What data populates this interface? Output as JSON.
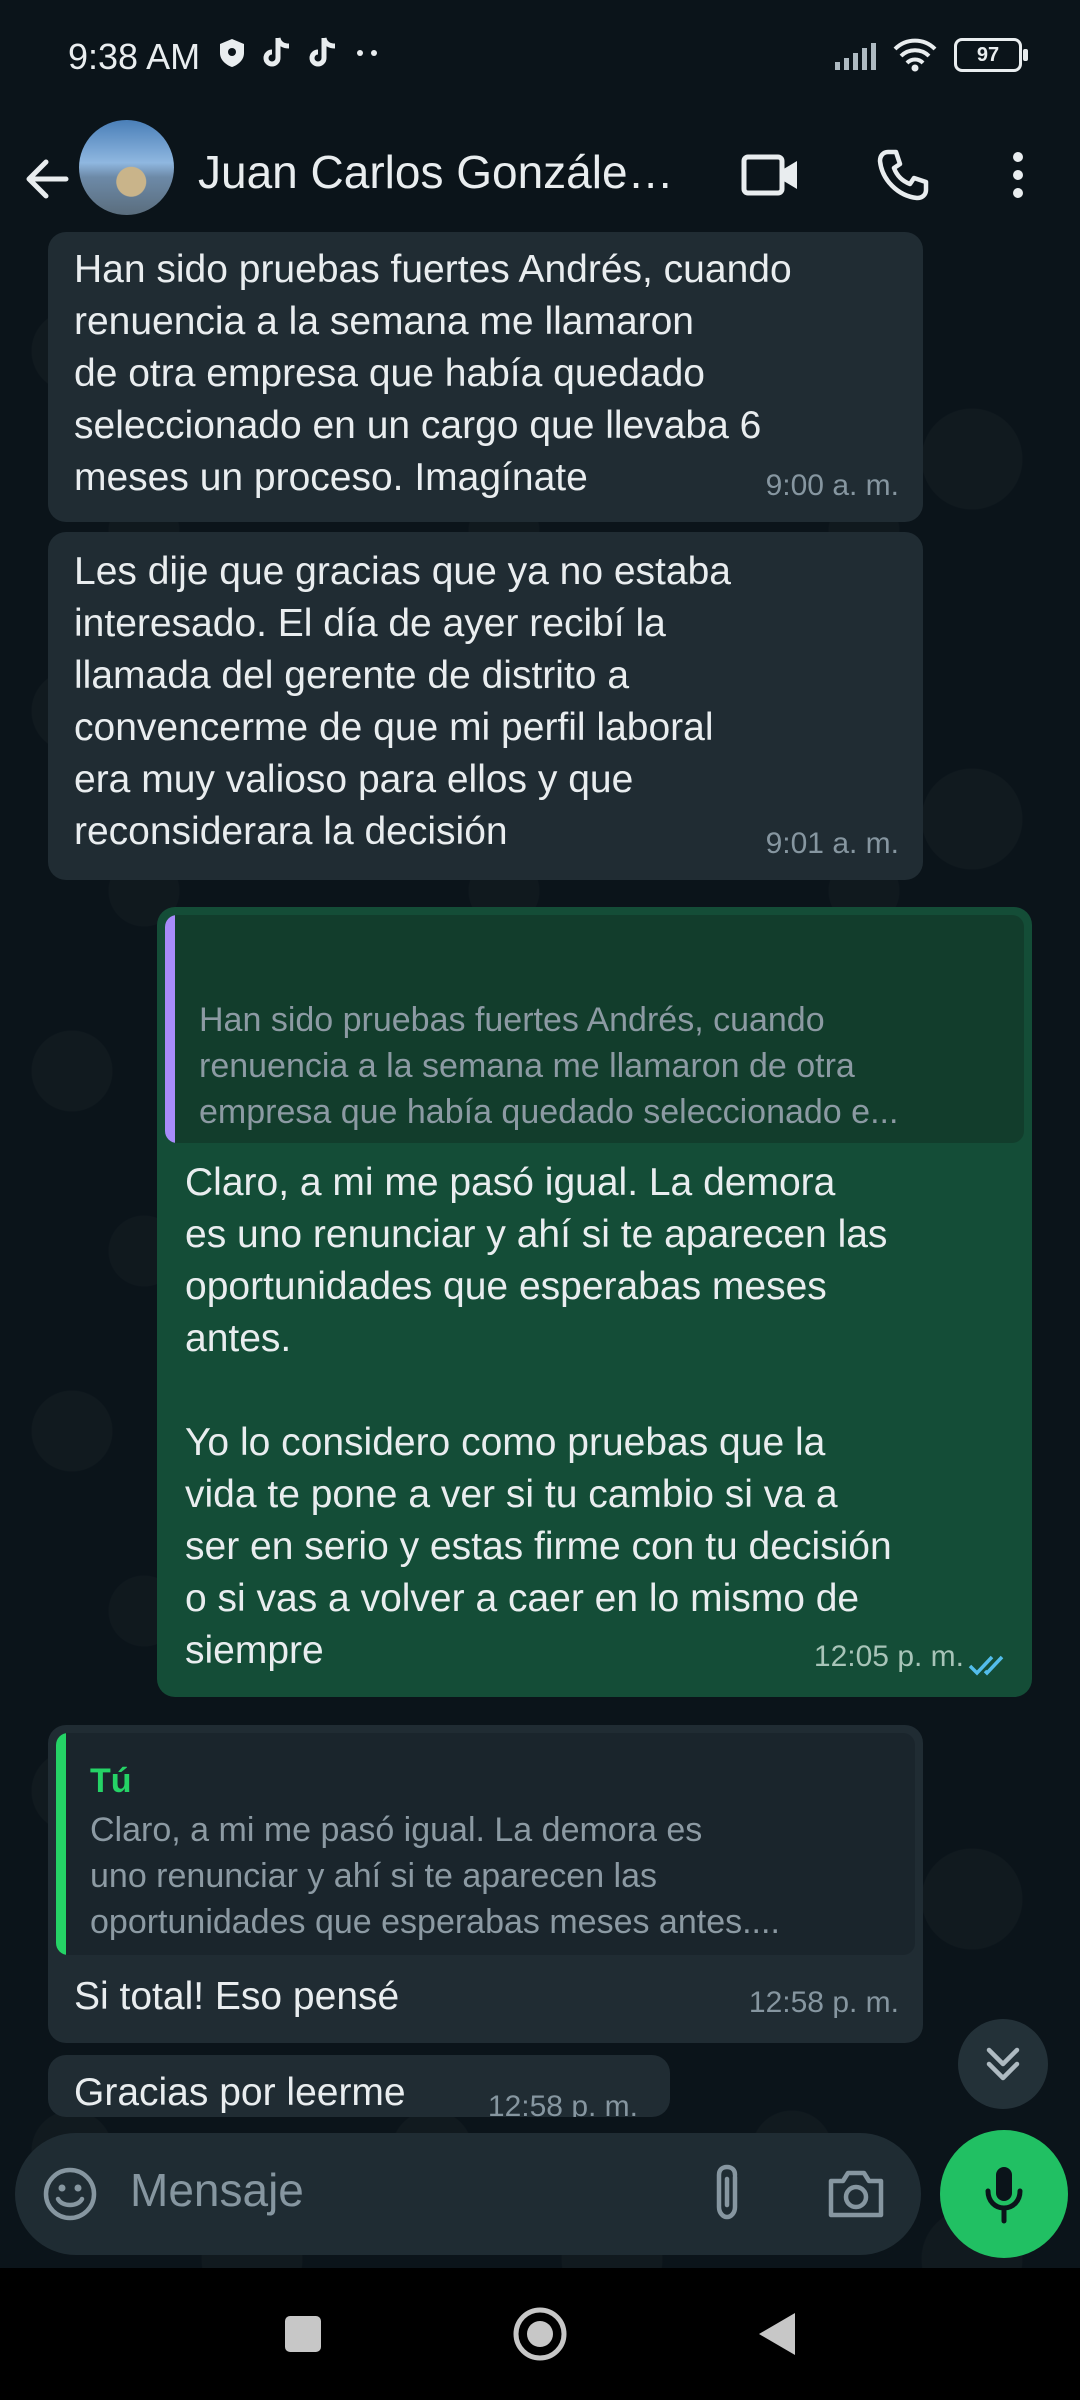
{
  "status_bar": {
    "time": "9:38 AM",
    "battery": "97",
    "left_icons": [
      "shield-icon",
      "tiktok-icon",
      "tiktok-icon",
      "more-dots-icon"
    ],
    "right_icons": [
      "signal-icon",
      "wifi-icon",
      "battery-icon"
    ]
  },
  "header": {
    "contact_name": "Juan Carlos Gonzále…",
    "icons": [
      "back-arrow-icon",
      "video-call-icon",
      "phone-call-icon",
      "more-vert-icon"
    ]
  },
  "messages": [
    {
      "direction": "in",
      "text": "Han sido pruebas fuertes Andrés, cuando\nrenuencia a la semana me llamaron\nde otra empresa que había quedado\nseleccionado en un cargo que llevaba 6\nmeses un proceso. Imagínate",
      "time": "9:00 a. m."
    },
    {
      "direction": "in",
      "text": "Les dije que gracias que ya no estaba\ninteresado. El día de ayer recibí la\nllamada del gerente de distrito a\nconvencerme de que mi perfil laboral\nera muy valioso para ellos y que\nreconsiderara la decisión",
      "time": "9:01 a. m."
    },
    {
      "direction": "out",
      "quote": "Han sido pruebas fuertes Andrés, cuando\nrenuencia a la semana me llamaron de otra\nempresa que había quedado seleccionado e...",
      "text": "Claro, a mi me pasó igual. La demora\nes uno renunciar y ahí si te aparecen las\noportunidades que esperabas meses\nantes.\n\nYo lo considero como pruebas que la\nvida te pone a ver si tu cambio si va a\nser en serio y estas firme con tu decisión\no si vas a volver a caer en lo mismo de\nsiempre",
      "time": "12:05 p. m."
    },
    {
      "direction": "in",
      "quote_author": "Tú",
      "quote": "Claro, a mi me pasó igual. La demora es\nuno renunciar y ahí si te aparecen las\noportunidades que esperabas meses antes....",
      "text": "Si total! Eso pensé",
      "time": "12:58 p. m."
    },
    {
      "direction": "in",
      "text": "Gracias por leerme",
      "time": "12:58 p. m."
    }
  ],
  "composer": {
    "placeholder": "Mensaje",
    "icons": [
      "emoji-icon",
      "attach-icon",
      "camera-icon",
      "mic-icon"
    ]
  },
  "colors": {
    "background": "#0b141a",
    "incoming_bubble": "#202c33",
    "outgoing_bubble": "#144d37",
    "accent_green": "#21c063",
    "read_ticks": "#53bdeb"
  }
}
